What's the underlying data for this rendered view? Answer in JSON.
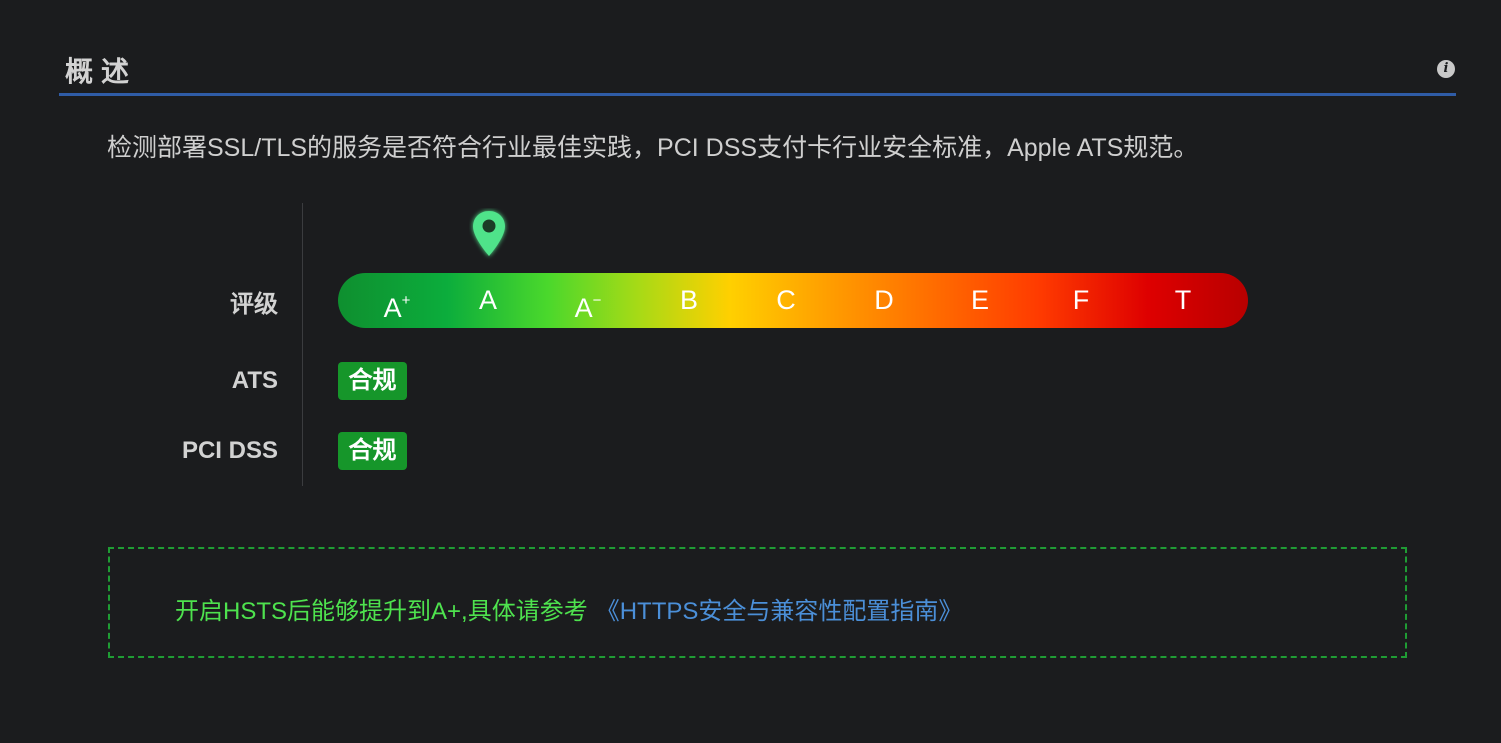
{
  "header": {
    "title": "概述",
    "info_icon": "info-icon"
  },
  "description": "检测部署SSL/TLS的服务是否符合行业最佳实践，PCI DSS支付卡行业安全标准，Apple ATS规范。",
  "rating": {
    "label": "评级",
    "current_grade": "A",
    "pin_icon": "map-pin-icon",
    "grades": [
      {
        "base": "A",
        "sup": "+"
      },
      {
        "base": "A",
        "sup": ""
      },
      {
        "base": "A",
        "sup": "−"
      },
      {
        "base": "B",
        "sup": ""
      },
      {
        "base": "C",
        "sup": ""
      },
      {
        "base": "D",
        "sup": ""
      },
      {
        "base": "E",
        "sup": ""
      },
      {
        "base": "F",
        "sup": ""
      },
      {
        "base": "T",
        "sup": ""
      }
    ],
    "gradient_colors": [
      "#0e8f2f",
      "#0cad3c",
      "#4ad82c",
      "#a7da16",
      "#ffd000",
      "#ff9900",
      "#ff6a00",
      "#ff3b00",
      "#de0000",
      "#b80000"
    ]
  },
  "ats": {
    "label": "ATS",
    "status": "合规"
  },
  "pci": {
    "label": "PCI DSS",
    "status": "合规"
  },
  "tip": {
    "text": "开启HSTS后能够提升到A+,具体请参考",
    "link": "《HTTPS安全与兼容性配置指南》"
  },
  "colors": {
    "accent": "#2f5ca7",
    "badge": "#16962a",
    "tip_green": "#4ee24e",
    "link_blue": "#4b8fd8",
    "pin": "#4fe38a"
  }
}
